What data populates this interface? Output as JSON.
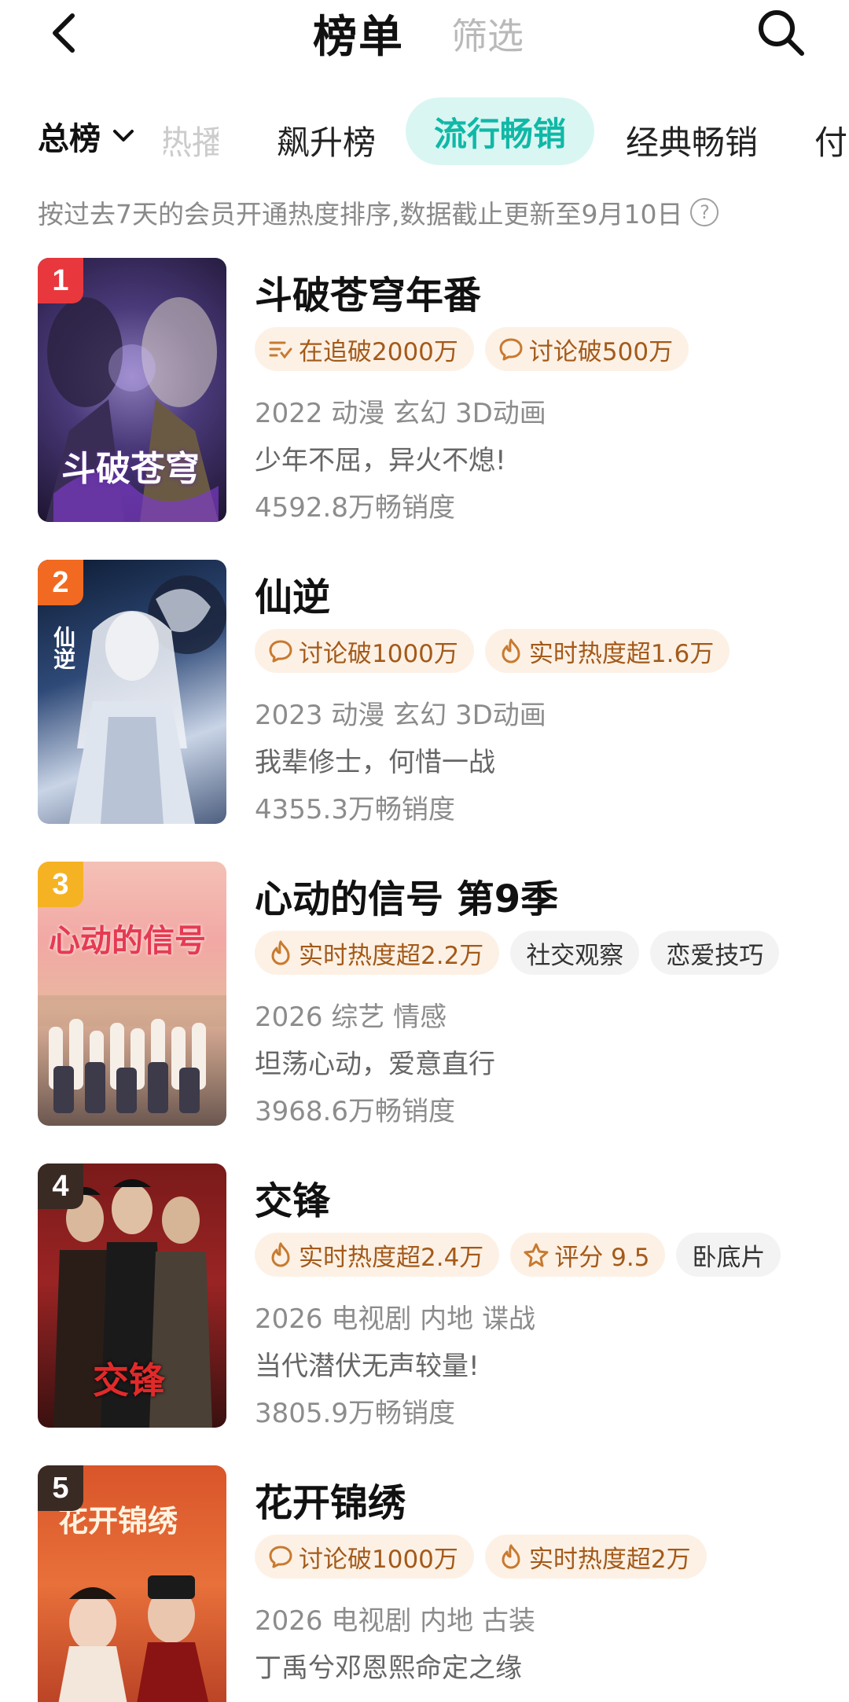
{
  "header": {
    "title": "榜单",
    "filter_label": "筛选",
    "back_icon": "chevron-left-icon",
    "search_icon": "search-icon"
  },
  "tabs": {
    "total_label": "总榜",
    "clipped_label": "热播榜",
    "items": [
      "飙升榜",
      "流行畅销",
      "经典畅销",
      "付"
    ],
    "active": "流行畅销",
    "active_color": "#10b8a6",
    "active_bg": "#d9f6f3"
  },
  "note": "按过去7天的会员开通热度排序,数据截止更新至9月10日",
  "items": [
    {
      "rank": "1",
      "rank_color": "#e8383d",
      "title": "斗破苍穹年番",
      "poster_caption": "斗破苍穹",
      "tags": [
        {
          "icon": "follow-list-icon",
          "text": "在追破2000万",
          "style": "hot"
        },
        {
          "icon": "comment-icon",
          "text": "讨论破500万",
          "style": "hot"
        }
      ],
      "meta": "2022 动漫 玄幻 3D动画",
      "desc": "少年不屈，异火不熄!",
      "sales": "4592.8万畅销度"
    },
    {
      "rank": "2",
      "rank_color": "#f26a21",
      "title": "仙逆",
      "poster_caption": "仙逆",
      "tags": [
        {
          "icon": "comment-icon",
          "text": "讨论破1000万",
          "style": "hot"
        },
        {
          "icon": "flame-icon",
          "text": "实时热度超1.6万",
          "style": "hot"
        }
      ],
      "meta": "2023 动漫 玄幻 3D动画",
      "desc": "我辈修士，何惜一战",
      "sales": "4355.3万畅销度"
    },
    {
      "rank": "3",
      "rank_color": "#f5b324",
      "title": "心动的信号 第9季",
      "poster_caption": "心动的信号",
      "tags": [
        {
          "icon": "flame-icon",
          "text": "实时热度超2.2万",
          "style": "hot"
        },
        {
          "icon": "",
          "text": "社交观察",
          "style": "plain"
        },
        {
          "icon": "",
          "text": "恋爱技巧",
          "style": "plain"
        }
      ],
      "meta": "2026 综艺 情感",
      "desc": "坦荡心动，爱意直行",
      "sales": "3968.6万畅销度"
    },
    {
      "rank": "4",
      "rank_color": "#3a2a24",
      "title": "交锋",
      "poster_caption": "交锋",
      "tags": [
        {
          "icon": "flame-icon",
          "text": "实时热度超2.4万",
          "style": "hot"
        },
        {
          "icon": "star-icon",
          "text": "评分 9.5",
          "style": "hot"
        },
        {
          "icon": "",
          "text": "卧底片",
          "style": "plain"
        }
      ],
      "meta": "2026 电视剧 内地 谍战",
      "desc": "当代潜伏无声较量!",
      "sales": "3805.9万畅销度"
    },
    {
      "rank": "5",
      "rank_color": "#3a2a24",
      "title": "花开锦绣",
      "poster_caption": "花开锦绣",
      "tags": [
        {
          "icon": "comment-icon",
          "text": "讨论破1000万",
          "style": "hot"
        },
        {
          "icon": "flame-icon",
          "text": "实时热度超2万",
          "style": "hot"
        }
      ],
      "meta": "2026 电视剧 内地 古装",
      "desc": "丁禹兮邓恩熙命定之缘",
      "sales": ""
    }
  ]
}
